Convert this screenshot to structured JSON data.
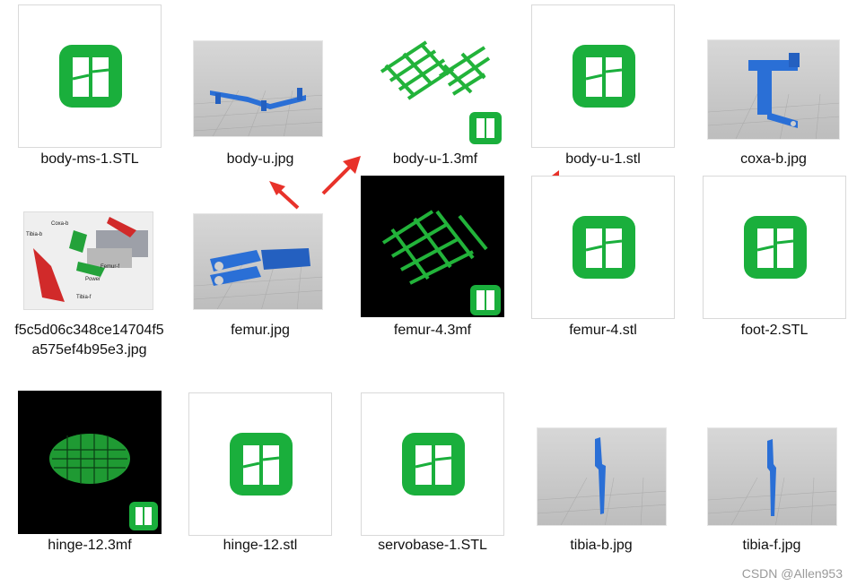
{
  "files": [
    {
      "name": "body-ms-1.STL",
      "thumb": "app-icon"
    },
    {
      "name": "body-u.jpg",
      "thumb": "photo-frame-part"
    },
    {
      "name": "body-u-1.3mf",
      "thumb": "green-lattice"
    },
    {
      "name": "body-u-1.stl",
      "thumb": "app-icon"
    },
    {
      "name": "coxa-b.jpg",
      "thumb": "photo-coxa"
    },
    {
      "name": "f5c5d06c348ce14704f5a575ef4b95e3.jpg",
      "thumb": "photo-assembly-diagram"
    },
    {
      "name": "femur.jpg",
      "thumb": "photo-femur"
    },
    {
      "name": "femur-4.3mf",
      "thumb": "green-lattice-black"
    },
    {
      "name": "femur-4.stl",
      "thumb": "app-icon"
    },
    {
      "name": "foot-2.STL",
      "thumb": "app-icon"
    },
    {
      "name": "hinge-12.3mf",
      "thumb": "green-lattice-black"
    },
    {
      "name": "hinge-12.stl",
      "thumb": "app-icon"
    },
    {
      "name": "servobase-1.STL",
      "thumb": "app-icon"
    },
    {
      "name": "tibia-b.jpg",
      "thumb": "photo-tibia"
    },
    {
      "name": "tibia-f.jpg",
      "thumb": "photo-tibia"
    }
  ],
  "diagram_labels": [
    "Coxa-b",
    "Tibia-b",
    "Femur-f",
    "Power",
    "Tibia-f"
  ],
  "watermark": "CSDN @Allen953",
  "colors": {
    "app_green": "#1aaf3c",
    "part_blue": "#2a6fd6",
    "arrow_red": "#e8322a",
    "lattice_green": "#22b33a"
  }
}
